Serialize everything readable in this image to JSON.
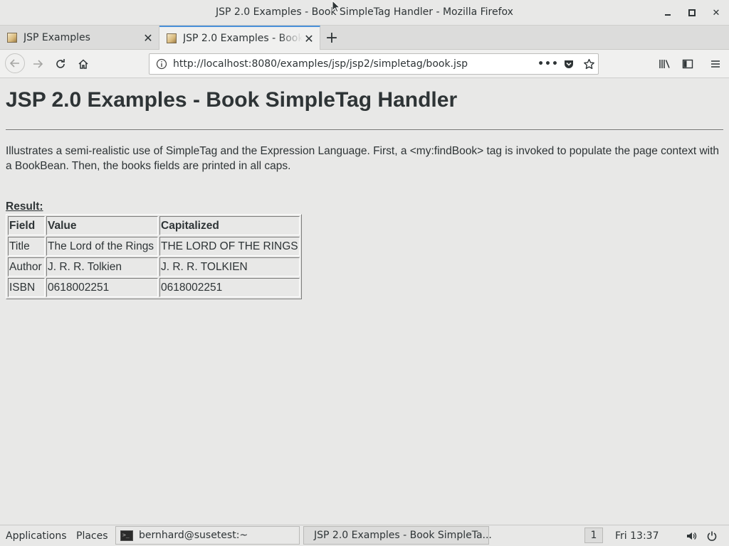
{
  "window": {
    "title": "JSP 2.0 Examples - Book SimpleTag Handler - Mozilla Firefox"
  },
  "tabs": [
    {
      "label": "JSP Examples",
      "active": false
    },
    {
      "label": "JSP 2.0 Examples - Book SimpleTag Handler",
      "active": true
    }
  ],
  "nav": {
    "url": "http://localhost:8080/examples/jsp/jsp2/simpletag/book.jsp",
    "more_label": "•••"
  },
  "page": {
    "heading": "JSP 2.0 Examples - Book SimpleTag Handler",
    "description": "Illustrates a semi-realistic use of SimpleTag and the Expression Language. First, a <my:findBook> tag is invoked to populate the page context with a BookBean. Then, the books fields are printed in all caps.",
    "result_label": "Result:",
    "table": {
      "headers": [
        "Field",
        "Value",
        "Capitalized"
      ],
      "rows": [
        [
          "Title",
          "The Lord of the Rings",
          "THE LORD OF THE RINGS"
        ],
        [
          "Author",
          "J. R. R. Tolkien",
          "J. R. R. TOLKIEN"
        ],
        [
          "ISBN",
          "0618002251",
          "0618002251"
        ]
      ]
    }
  },
  "taskbar": {
    "applications": "Applications",
    "places": "Places",
    "terminal_window": "bernhard@susetest:~",
    "firefox_window": "JSP 2.0 Examples - Book SimpleTa...",
    "workspace": "1",
    "clock": "Fri 13:37"
  },
  "icons": {
    "minimize": "minimize-icon",
    "maximize": "maximize-icon",
    "close": "close-icon",
    "back": "back-arrow-icon",
    "forward": "forward-arrow-icon",
    "reload": "reload-icon",
    "home": "home-icon",
    "info": "info-icon",
    "pocket": "pocket-icon",
    "bookmark": "star-icon",
    "library": "library-icon",
    "sidebar": "sidebar-icon",
    "menu": "hamburger-menu-icon",
    "volume": "volume-icon",
    "power": "power-icon"
  }
}
